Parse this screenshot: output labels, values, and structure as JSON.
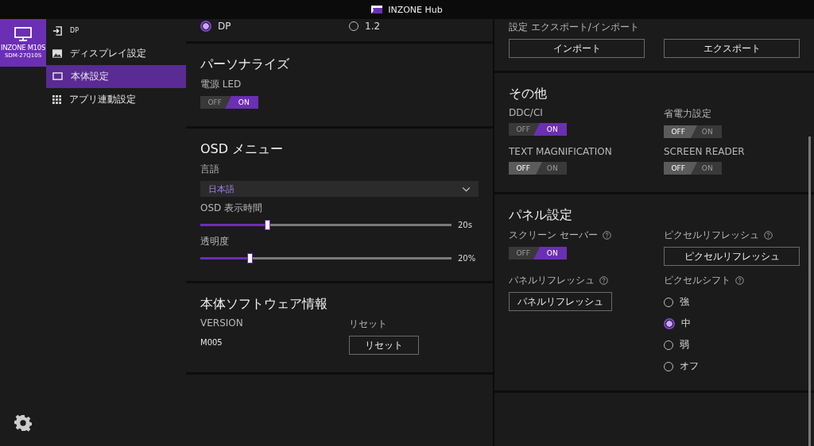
{
  "title_bar": {
    "title": "INZONE Hub"
  },
  "device": {
    "name": "INZONE M10S",
    "model": "SDM-27Q10S"
  },
  "sidebar": {
    "items": [
      {
        "label": "DP",
        "selected": false
      },
      {
        "label": "ディスプレイ設定",
        "selected": false
      },
      {
        "label": "本体設定",
        "selected": true
      },
      {
        "label": "アプリ連動設定",
        "selected": false
      }
    ]
  },
  "left_sections": [
    {
      "items": [
        {
          "kind": "radio",
          "label": "DP",
          "selected": true
        },
        {
          "kind": "radio",
          "label": "1.2",
          "selected": false
        }
      ]
    },
    {
      "heading": "パーソナライズ",
      "items": [
        {
          "kind": "toggle",
          "label": "電源 LED",
          "on": true,
          "off_text": "OFF",
          "on_text": "ON"
        }
      ]
    },
    {
      "heading": "OSD メニュー",
      "items": [
        {
          "kind": "dropdown",
          "label": "言語",
          "value": "日本語"
        },
        {
          "kind": "slider",
          "label": "OSD 表示時間",
          "level": 0.27,
          "reading": "20s"
        },
        {
          "kind": "slider",
          "label": "透明度",
          "level": 0.2,
          "reading": "20%"
        }
      ]
    },
    {
      "heading": "本体ソフトウェア情報",
      "items": [
        {
          "kind": "text",
          "label": "VERSION",
          "value": "M005"
        },
        {
          "kind": "button",
          "label": "リセット",
          "button": "リセット"
        }
      ]
    }
  ],
  "right_sections": [
    {
      "items": [
        {
          "kind": "widebutton",
          "label": "設定 エクスポート/インポート",
          "button": "インポート"
        },
        {
          "kind": "widebutton",
          "button": "エクスポート"
        }
      ]
    },
    {
      "heading": "その他",
      "items": [
        {
          "kind": "toggle",
          "label": "DDC/CI",
          "on": true,
          "off_text": "OFF",
          "on_text": "ON"
        },
        {
          "kind": "toggle",
          "label": "省電力設定",
          "on": false,
          "off_text": "OFF",
          "on_text": "ON"
        },
        {
          "kind": "toggle",
          "label": "TEXT MAGNIFICATION",
          "on": false,
          "off_text": "OFF",
          "on_text": "ON"
        },
        {
          "kind": "toggle",
          "label": "SCREEN READER",
          "on": false,
          "off_text": "OFF",
          "on_text": "ON"
        }
      ]
    },
    {
      "heading": "パネル設定",
      "items": [
        {
          "kind": "toggle",
          "label": "スクリーン セーバー",
          "help": true,
          "on": true,
          "off_text": "OFF",
          "on_text": "ON"
        },
        {
          "kind": "widebutton",
          "label": "ピクセルリフレッシュ",
          "help": true,
          "button": "ピクセルリフレッシュ"
        },
        {
          "kind": "button",
          "label": "パネルリフレッシュ",
          "help": true,
          "button": "パネルリフレッシュ"
        },
        {
          "kind": "radios",
          "label": "ピクセルシフト",
          "help": true,
          "options": [
            {
              "label": "強",
              "selected": false
            },
            {
              "label": "中",
              "selected": true
            },
            {
              "label": "弱",
              "selected": false
            },
            {
              "label": "オフ",
              "selected": false
            }
          ]
        }
      ]
    }
  ]
}
